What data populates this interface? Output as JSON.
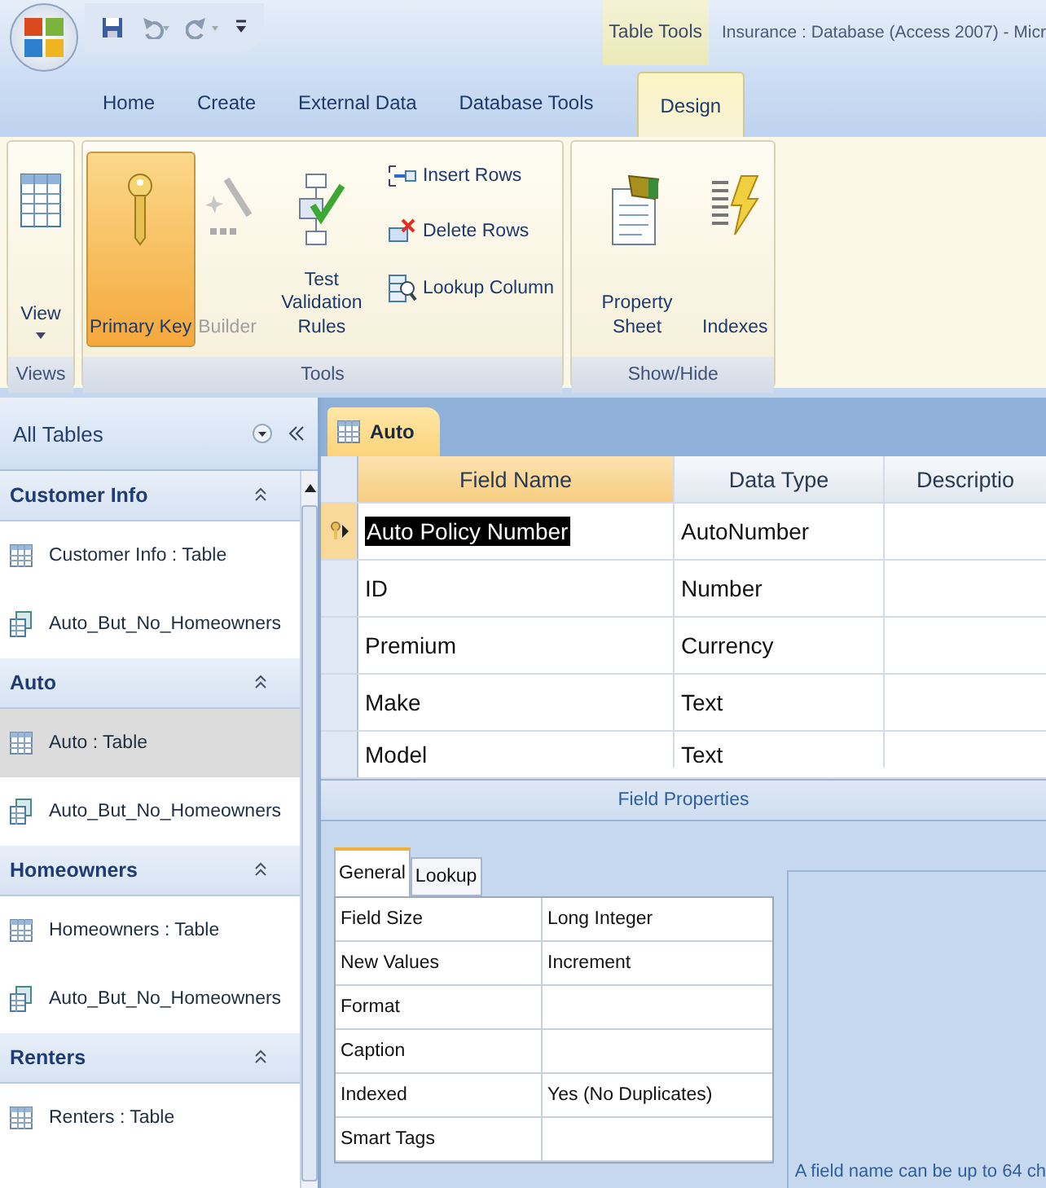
{
  "window": {
    "title": "Insurance : Database (Access 2007) - Micr"
  },
  "contextual_tab_group": "Table Tools",
  "ribbon_tabs": [
    {
      "label": "Home",
      "selected": false
    },
    {
      "label": "Create",
      "selected": false
    },
    {
      "label": "External Data",
      "selected": false
    },
    {
      "label": "Database Tools",
      "selected": false
    },
    {
      "label": "Design",
      "selected": true
    }
  ],
  "ribbon_groups": [
    {
      "label": "Views",
      "buttons": [
        {
          "kind": "view",
          "label": "View",
          "pressed": false,
          "disabled": false
        }
      ]
    },
    {
      "label": "Tools",
      "buttons": [
        {
          "kind": "key",
          "label": "Primary Key",
          "pressed": true,
          "disabled": false
        },
        {
          "kind": "builder",
          "label": "Builder",
          "pressed": false,
          "disabled": true
        },
        {
          "kind": "validate",
          "label": "Test Validation Rules",
          "pressed": false,
          "disabled": false
        },
        {
          "kind": "insert",
          "label": "Insert Rows",
          "pressed": false,
          "disabled": false
        },
        {
          "kind": "delete",
          "label": "Delete Rows",
          "pressed": false,
          "disabled": false
        },
        {
          "kind": "lookup",
          "label": "Lookup Column",
          "pressed": false,
          "disabled": false
        }
      ]
    },
    {
      "label": "Show/Hide",
      "buttons": [
        {
          "kind": "sheet",
          "label": "Property Sheet",
          "pressed": false,
          "disabled": false
        },
        {
          "kind": "indexes",
          "label": "Indexes",
          "pressed": false,
          "disabled": false
        }
      ]
    }
  ],
  "navigation_pane": {
    "title": "All Tables",
    "groups": [
      {
        "label": "Customer Info",
        "expanded": true,
        "items": [
          {
            "kind": "table",
            "label": "Customer Info : Table",
            "selected": false
          },
          {
            "kind": "query",
            "label": "Auto_But_No_Homeowners",
            "selected": false
          }
        ]
      },
      {
        "label": "Auto",
        "expanded": true,
        "items": [
          {
            "kind": "table",
            "label": "Auto : Table",
            "selected": true
          },
          {
            "kind": "query",
            "label": "Auto_But_No_Homeowners",
            "selected": false
          }
        ]
      },
      {
        "label": "Homeowners",
        "expanded": true,
        "items": [
          {
            "kind": "table",
            "label": "Homeowners : Table",
            "selected": false
          },
          {
            "kind": "query",
            "label": "Auto_But_No_Homeowners",
            "selected": false
          }
        ]
      },
      {
        "label": "Renters",
        "expanded": true,
        "items": [
          {
            "kind": "table",
            "label": "Renters : Table",
            "selected": false
          }
        ]
      }
    ]
  },
  "document_tab": {
    "label": "Auto"
  },
  "design_grid": {
    "columns": [
      "Field Name",
      "Data Type",
      "Descriptio"
    ],
    "rows": [
      {
        "field_name": "Auto Policy Number",
        "data_type": "AutoNumber",
        "primary_key": true,
        "current": true
      },
      {
        "field_name": "ID",
        "data_type": "Number",
        "primary_key": false,
        "current": false
      },
      {
        "field_name": "Premium",
        "data_type": "Currency",
        "primary_key": false,
        "current": false
      },
      {
        "field_name": "Make",
        "data_type": "Text",
        "primary_key": false,
        "current": false
      },
      {
        "field_name": "Model",
        "data_type": "Text",
        "primary_key": false,
        "current": false
      }
    ]
  },
  "field_properties": {
    "title": "Field Properties",
    "tabs": [
      {
        "label": "General",
        "selected": true
      },
      {
        "label": "Lookup",
        "selected": false
      }
    ],
    "rows": [
      {
        "label": "Field Size",
        "value": "Long Integer"
      },
      {
        "label": "New Values",
        "value": "Increment"
      },
      {
        "label": "Format",
        "value": ""
      },
      {
        "label": "Caption",
        "value": ""
      },
      {
        "label": "Indexed",
        "value": "Yes (No Duplicates)"
      },
      {
        "label": "Smart Tags",
        "value": ""
      }
    ],
    "help_text": "A field name can be up to 64 ch"
  }
}
